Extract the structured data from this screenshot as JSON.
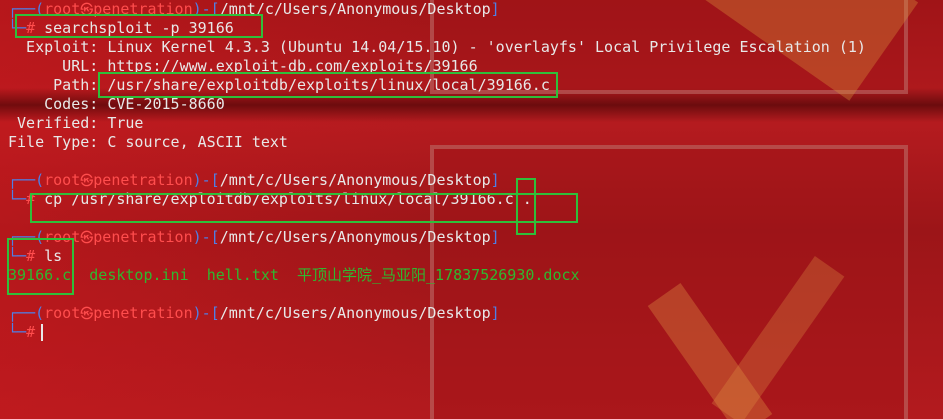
{
  "prompt": {
    "user": "root",
    "skull": "㉿",
    "host": "penetration",
    "path": "/mnt/c/Users/Anonymous/Desktop",
    "hash": "#"
  },
  "commands": {
    "searchsploit": "searchsploit -p 39166",
    "cp": "cp /usr/share/exploitdb/exploits/linux/local/39166.c .",
    "ls": "ls"
  },
  "exploit_info": [
    {
      "key": "  Exploit:",
      "value": "Linux Kernel 4.3.3 (Ubuntu 14.04/15.10) - 'overlayfs' Local Privilege Escalation (1)"
    },
    {
      "key": "      URL:",
      "value": "https://www.exploit-db.com/exploits/39166"
    },
    {
      "key": "     Path:",
      "value": "/usr/share/exploitdb/exploits/linux/local/39166.c"
    },
    {
      "key": "    Codes:",
      "value": "CVE-2015-8660"
    },
    {
      "key": " Verified:",
      "value": "True"
    },
    {
      "key": "File Type:",
      "value": "C source, ASCII text"
    }
  ],
  "ls_output": [
    "39166.c",
    "desktop.ini",
    "hell.txt",
    "平顶山学院_马亚阳_17837526930.docx"
  ],
  "colors": {
    "prompt_frame": "#4f7fe6",
    "prompt_user": "#ff4d4d",
    "highlight_box": "#2fbf3a",
    "ls_files": "#2fb82f"
  }
}
